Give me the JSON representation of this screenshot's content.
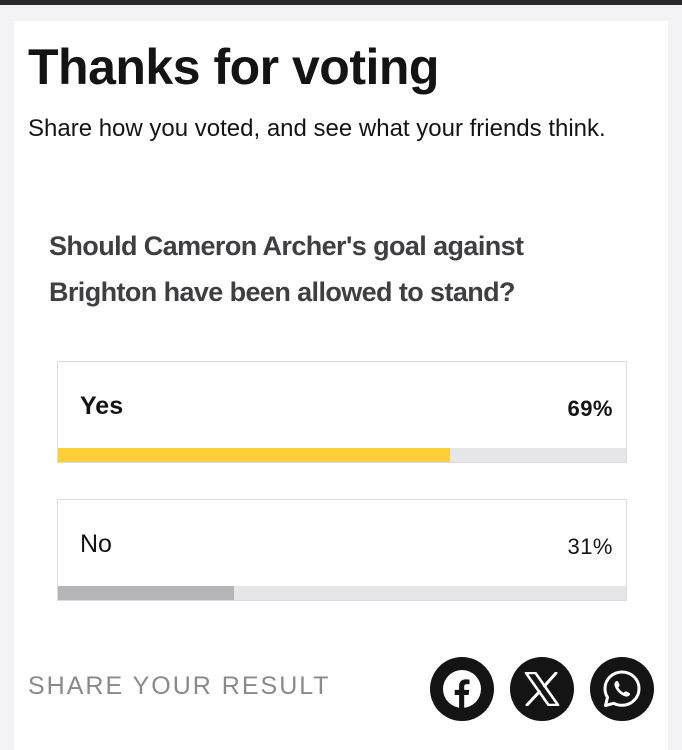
{
  "header": {
    "title": "Thanks for voting",
    "subtitle": "Share how you voted, and see what your friends think."
  },
  "poll": {
    "question": "Should Cameron Archer's goal against Brighton have been allowed to stand?",
    "options": [
      {
        "label": "Yes",
        "percent_text": "69%",
        "percent": 69,
        "selected": true,
        "bar_color": "#fccf37"
      },
      {
        "label": "No",
        "percent_text": "31%",
        "percent": 31,
        "selected": false,
        "bar_color": "#b5b5b8"
      }
    ]
  },
  "share": {
    "label": "SHARE YOUR RESULT",
    "buttons": [
      {
        "icon": "facebook-icon"
      },
      {
        "icon": "x-icon"
      },
      {
        "icon": "whatsapp-icon"
      }
    ]
  },
  "colors": {
    "accent": "#fccf37",
    "text": "#141414",
    "muted": "#8a8a8e",
    "track": "#e6e6e8"
  }
}
